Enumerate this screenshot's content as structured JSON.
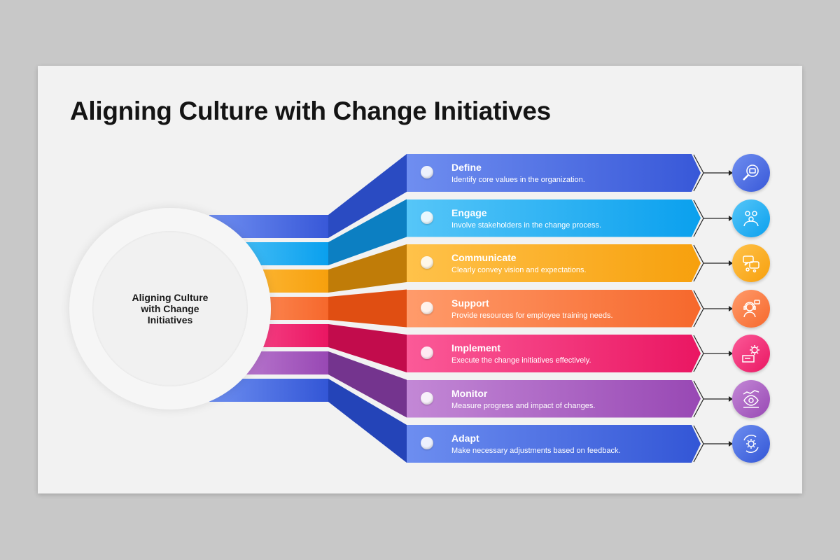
{
  "title": "Aligning Culture with Change Initiatives",
  "hub": {
    "text": "Aligning Culture with Change Initiatives"
  },
  "steps": [
    {
      "title": "Define",
      "desc": "Identify core values in the organization.",
      "color_light": "#6f8ef0",
      "color_dark": "#3858d8",
      "shade": "#2a4bc2",
      "icon": "magnifier-icon"
    },
    {
      "title": "Engage",
      "desc": "Involve stakeholders in the change process.",
      "color_light": "#56c6f8",
      "color_dark": "#0aa0ee",
      "shade": "#0c7fc2",
      "icon": "stakeholders-icon"
    },
    {
      "title": "Communicate",
      "desc": "Clearly convey vision and expectations.",
      "color_light": "#ffc24a",
      "color_dark": "#f7a00d",
      "shade": "#c07c08",
      "icon": "chat-icon"
    },
    {
      "title": "Support",
      "desc": "Provide resources for employee training needs.",
      "color_light": "#ff9b6b",
      "color_dark": "#f6682c",
      "shade": "#e04e12",
      "icon": "support-agent-icon"
    },
    {
      "title": "Implement",
      "desc": "Execute the change initiatives effectively.",
      "color_light": "#fb5a98",
      "color_dark": "#ea1662",
      "shade": "#c20c4c",
      "icon": "gear-board-icon"
    },
    {
      "title": "Monitor",
      "desc": "Measure progress and impact of changes.",
      "color_light": "#c388d6",
      "color_dark": "#9848b4",
      "shade": "#74348e",
      "icon": "eye-chart-icon"
    },
    {
      "title": "Adapt",
      "desc": "Make necessary adjustments based on feedback.",
      "color_light": "#6d8ef0",
      "color_dark": "#3356d6",
      "shade": "#2444b8",
      "icon": "gear-cycle-icon"
    }
  ]
}
